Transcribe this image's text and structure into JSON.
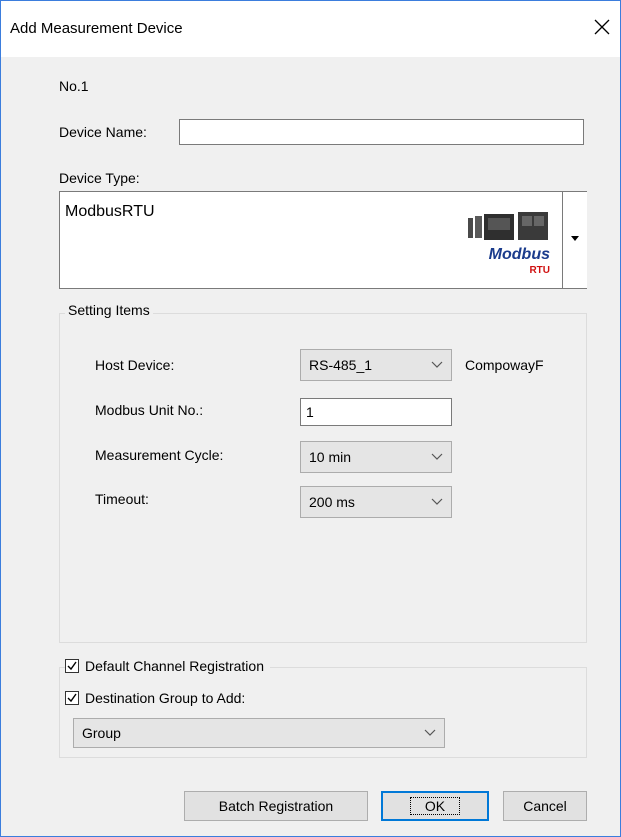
{
  "window": {
    "title": "Add Measurement Device"
  },
  "device_number": "No.1",
  "device_name": {
    "label": "Device Name:",
    "value": ""
  },
  "device_type": {
    "label": "Device Type:",
    "value": "ModbusRTU",
    "logo_text": "Modbus",
    "logo_subtext": "RTU"
  },
  "setting_items": {
    "caption": "Setting Items",
    "host_device": {
      "label": "Host Device:",
      "value": "RS-485_1",
      "protocol": "CompowayF"
    },
    "modbus_unit_no": {
      "label": "Modbus Unit No.:",
      "value": "1"
    },
    "measurement_cycle": {
      "label": "Measurement Cycle:",
      "value": "10 min"
    },
    "timeout": {
      "label": "Timeout:",
      "value": "200 ms"
    }
  },
  "options": {
    "default_channel_registration": {
      "label": "Default Channel Registration",
      "checked": true
    },
    "destination_group": {
      "label": "Destination Group to Add:",
      "checked": true,
      "value": "Group"
    }
  },
  "buttons": {
    "batch": "Batch Registration",
    "ok": "OK",
    "cancel": "Cancel"
  }
}
